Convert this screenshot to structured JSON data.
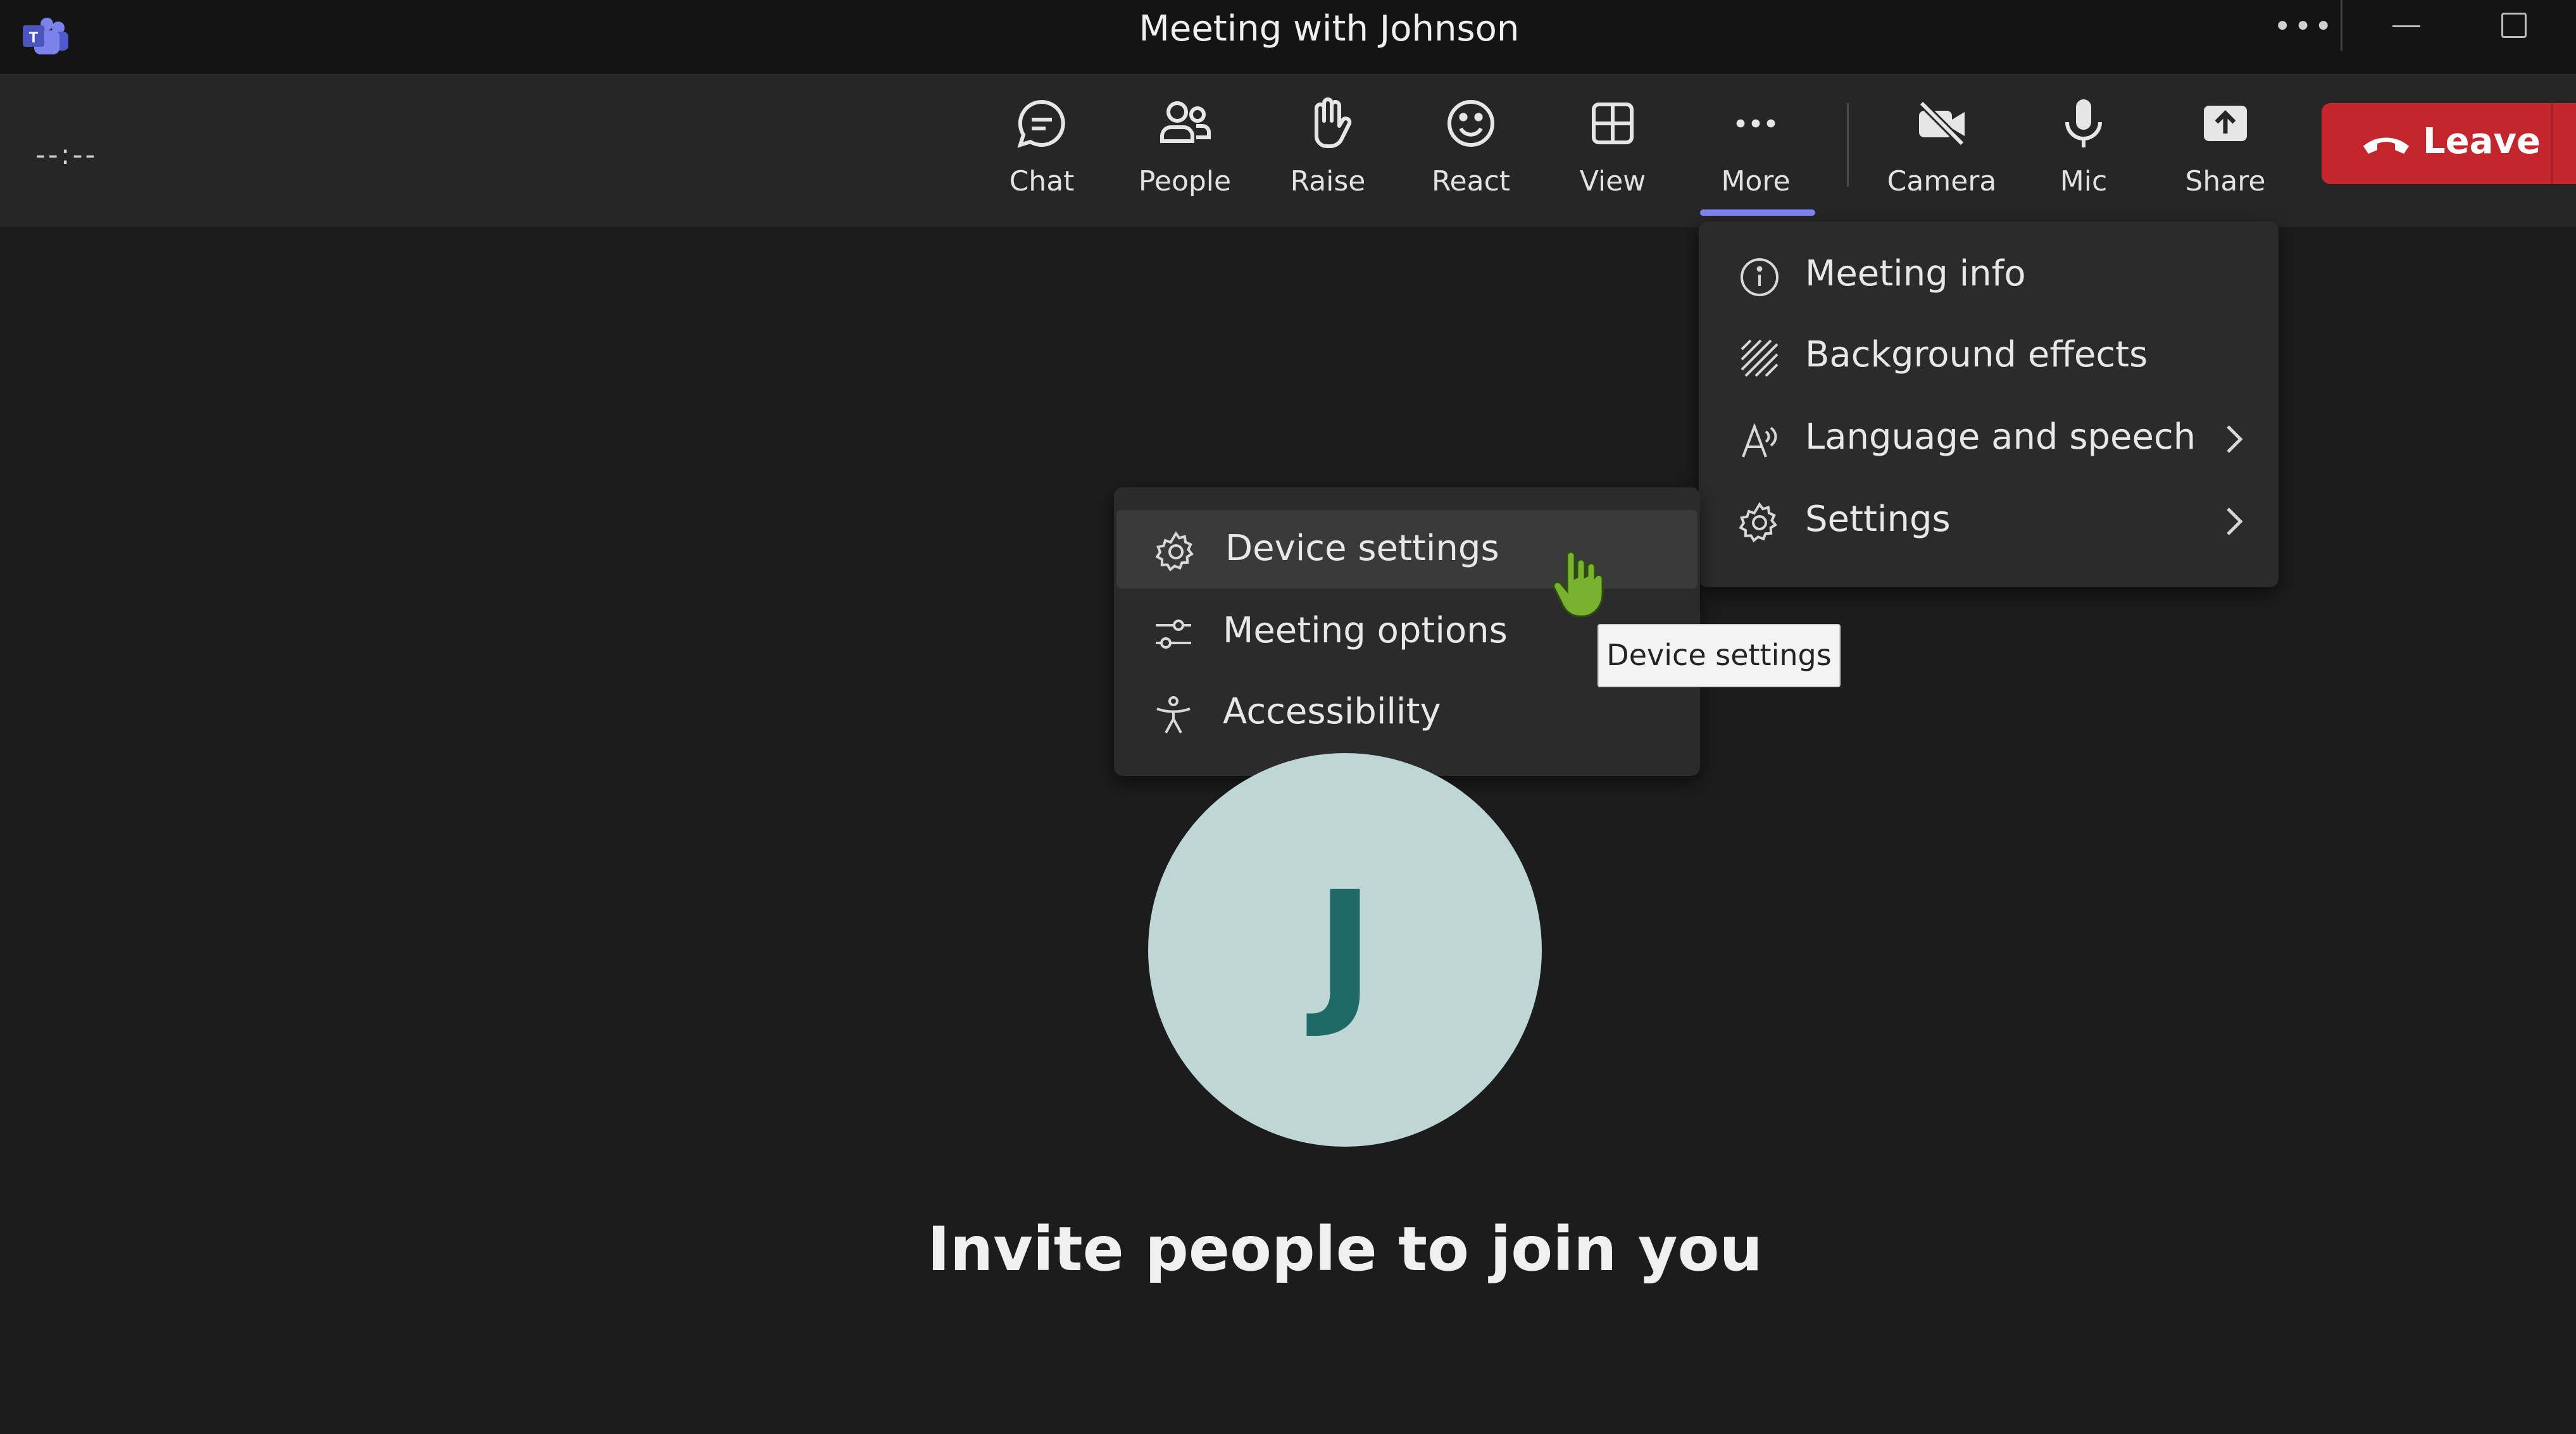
{
  "window": {
    "title": "Meeting with Johnson",
    "more_glyph": "•••"
  },
  "timer": "--:--",
  "toolbar": {
    "items": [
      {
        "label": "Chat",
        "icon": "chat-icon"
      },
      {
        "label": "People",
        "icon": "people-icon"
      },
      {
        "label": "Raise",
        "icon": "raise-hand-icon"
      },
      {
        "label": "React",
        "icon": "smiley-icon"
      },
      {
        "label": "View",
        "icon": "grid-icon"
      },
      {
        "label": "More",
        "icon": "more-icon"
      },
      {
        "label": "Camera",
        "icon": "camera-off-icon"
      },
      {
        "label": "Mic",
        "icon": "mic-icon"
      },
      {
        "label": "Share",
        "icon": "share-icon"
      }
    ],
    "leave_label": "Leave",
    "active": "More"
  },
  "more_menu": {
    "items": [
      {
        "label": "Meeting info",
        "icon": "info-icon"
      },
      {
        "label": "Background effects",
        "icon": "background-effects-icon"
      },
      {
        "label": "Language and speech",
        "icon": "language-icon",
        "submenu": true
      },
      {
        "label": "Settings",
        "icon": "gear-icon",
        "submenu": true
      }
    ]
  },
  "settings_submenu": {
    "items": [
      {
        "label": "Device settings",
        "icon": "gear-icon",
        "hovered": true
      },
      {
        "label": "Meeting options",
        "icon": "sliders-icon"
      },
      {
        "label": "Accessibility",
        "icon": "accessibility-icon"
      }
    ]
  },
  "tooltip": "Device settings",
  "participant": {
    "initial": "J"
  },
  "stage": {
    "invite_text": "Invite people to join you"
  },
  "colors": {
    "leave": "#c4262e",
    "accent": "#7f85f5",
    "avatar_bg": "#bfd6d6",
    "avatar_text": "#1f6a66"
  }
}
